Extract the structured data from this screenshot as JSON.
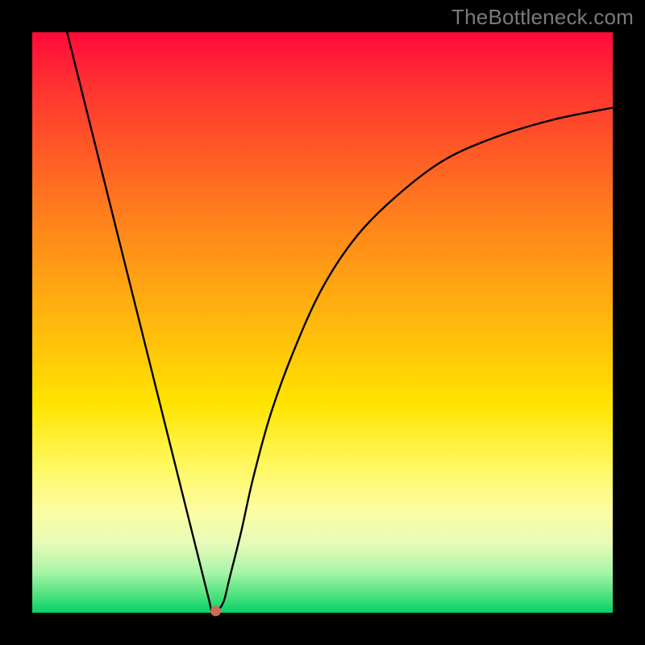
{
  "watermark": "TheBottleneck.com",
  "chart_data": {
    "type": "line",
    "title": "",
    "xlabel": "",
    "ylabel": "",
    "xlim": [
      0,
      100
    ],
    "ylim": [
      0,
      100
    ],
    "grid": false,
    "series": [
      {
        "name": "bottleneck-curve",
        "x": [
          6,
          10,
          14,
          18,
          22,
          25,
          28,
          29.5,
          30.5,
          31,
          32,
          33,
          34,
          36,
          38,
          41,
          45,
          50,
          56,
          63,
          71,
          80,
          90,
          100
        ],
        "y": [
          100,
          84,
          68,
          52,
          36,
          24,
          12,
          6,
          2,
          0,
          0.5,
          2,
          6,
          14,
          23,
          34,
          45,
          56,
          65,
          72,
          78,
          82,
          85,
          87
        ]
      }
    ],
    "marker": {
      "x": 31.6,
      "y": 0.3,
      "color": "#cd6b54"
    },
    "gradient_stops": [
      {
        "pos": 0.0,
        "color": "#ff0a3a"
      },
      {
        "pos": 0.08,
        "color": "#ff2d33"
      },
      {
        "pos": 0.18,
        "color": "#ff5128"
      },
      {
        "pos": 0.3,
        "color": "#ff7a1e"
      },
      {
        "pos": 0.42,
        "color": "#ffa014"
      },
      {
        "pos": 0.54,
        "color": "#ffc40a"
      },
      {
        "pos": 0.64,
        "color": "#ffe400"
      },
      {
        "pos": 0.74,
        "color": "#fff75a"
      },
      {
        "pos": 0.82,
        "color": "#fdfda0"
      },
      {
        "pos": 0.88,
        "color": "#e8fbb8"
      },
      {
        "pos": 0.93,
        "color": "#a8f5a8"
      },
      {
        "pos": 0.97,
        "color": "#4de27e"
      },
      {
        "pos": 1.0,
        "color": "#05d169"
      }
    ]
  }
}
